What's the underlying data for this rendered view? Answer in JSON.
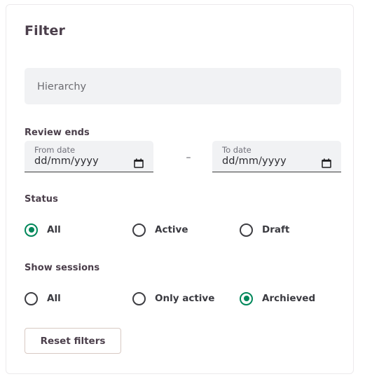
{
  "card": {
    "title": "Filter"
  },
  "hierarchy": {
    "name": "hierarchy-select",
    "placeholder": "Hierarchy",
    "value": ""
  },
  "review_ends": {
    "label": "Review ends",
    "separator": "–",
    "from": {
      "caption": "From date",
      "value": "dd/mm/yyyy",
      "icon": "calendar-icon"
    },
    "to": {
      "caption": "To date",
      "value": "dd/mm/yyyy",
      "icon": "calendar-icon"
    }
  },
  "status": {
    "label": "Status",
    "options": [
      {
        "label": "All",
        "checked": true
      },
      {
        "label": "Active",
        "checked": false
      },
      {
        "label": "Draft",
        "checked": false
      }
    ]
  },
  "show_sessions": {
    "label": "Show sessions",
    "options": [
      {
        "label": "All",
        "checked": false
      },
      {
        "label": "Only active",
        "checked": false
      },
      {
        "label": "Archieved",
        "checked": true
      }
    ]
  },
  "actions": {
    "reset_label": "Reset filters"
  },
  "colors": {
    "accent_green": "#00875a",
    "heading": "#4b3f4b",
    "field_fill": "#f1f2f4",
    "button_border": "#d8c9c3",
    "card_border": "#eceaec"
  }
}
